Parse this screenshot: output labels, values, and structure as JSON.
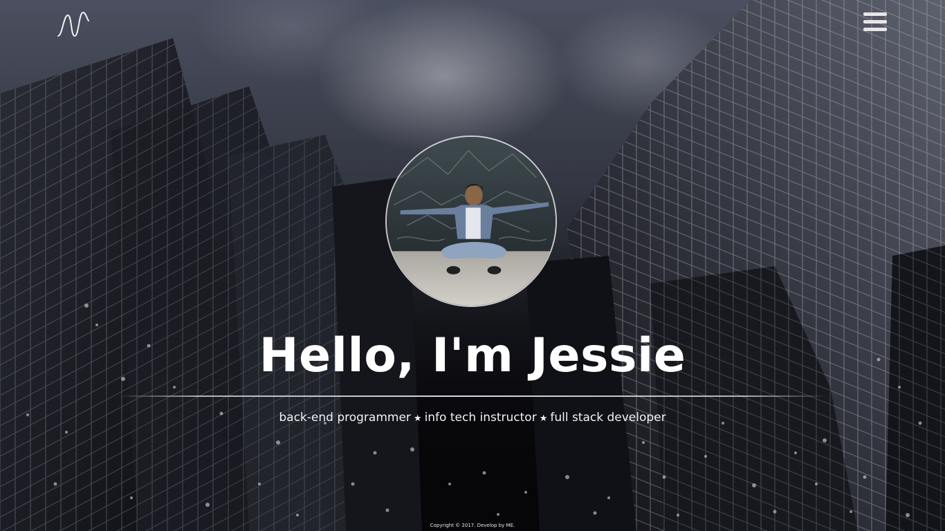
{
  "header": {
    "logo_icon": "wave-logo-icon",
    "menu_icon": "hamburger-menu-icon"
  },
  "hero": {
    "headline": "Hello, I'm Jessie",
    "roles": [
      "back-end programmer",
      "info tech instructor",
      "full stack developer"
    ],
    "separator_icon": "star-icon"
  },
  "footer": {
    "copyright": "Copyright © 2017. Develop by ME."
  },
  "colors": {
    "text": "#ffffff",
    "background": "#0b0b0e",
    "accent_line": "#e6e6ea"
  }
}
